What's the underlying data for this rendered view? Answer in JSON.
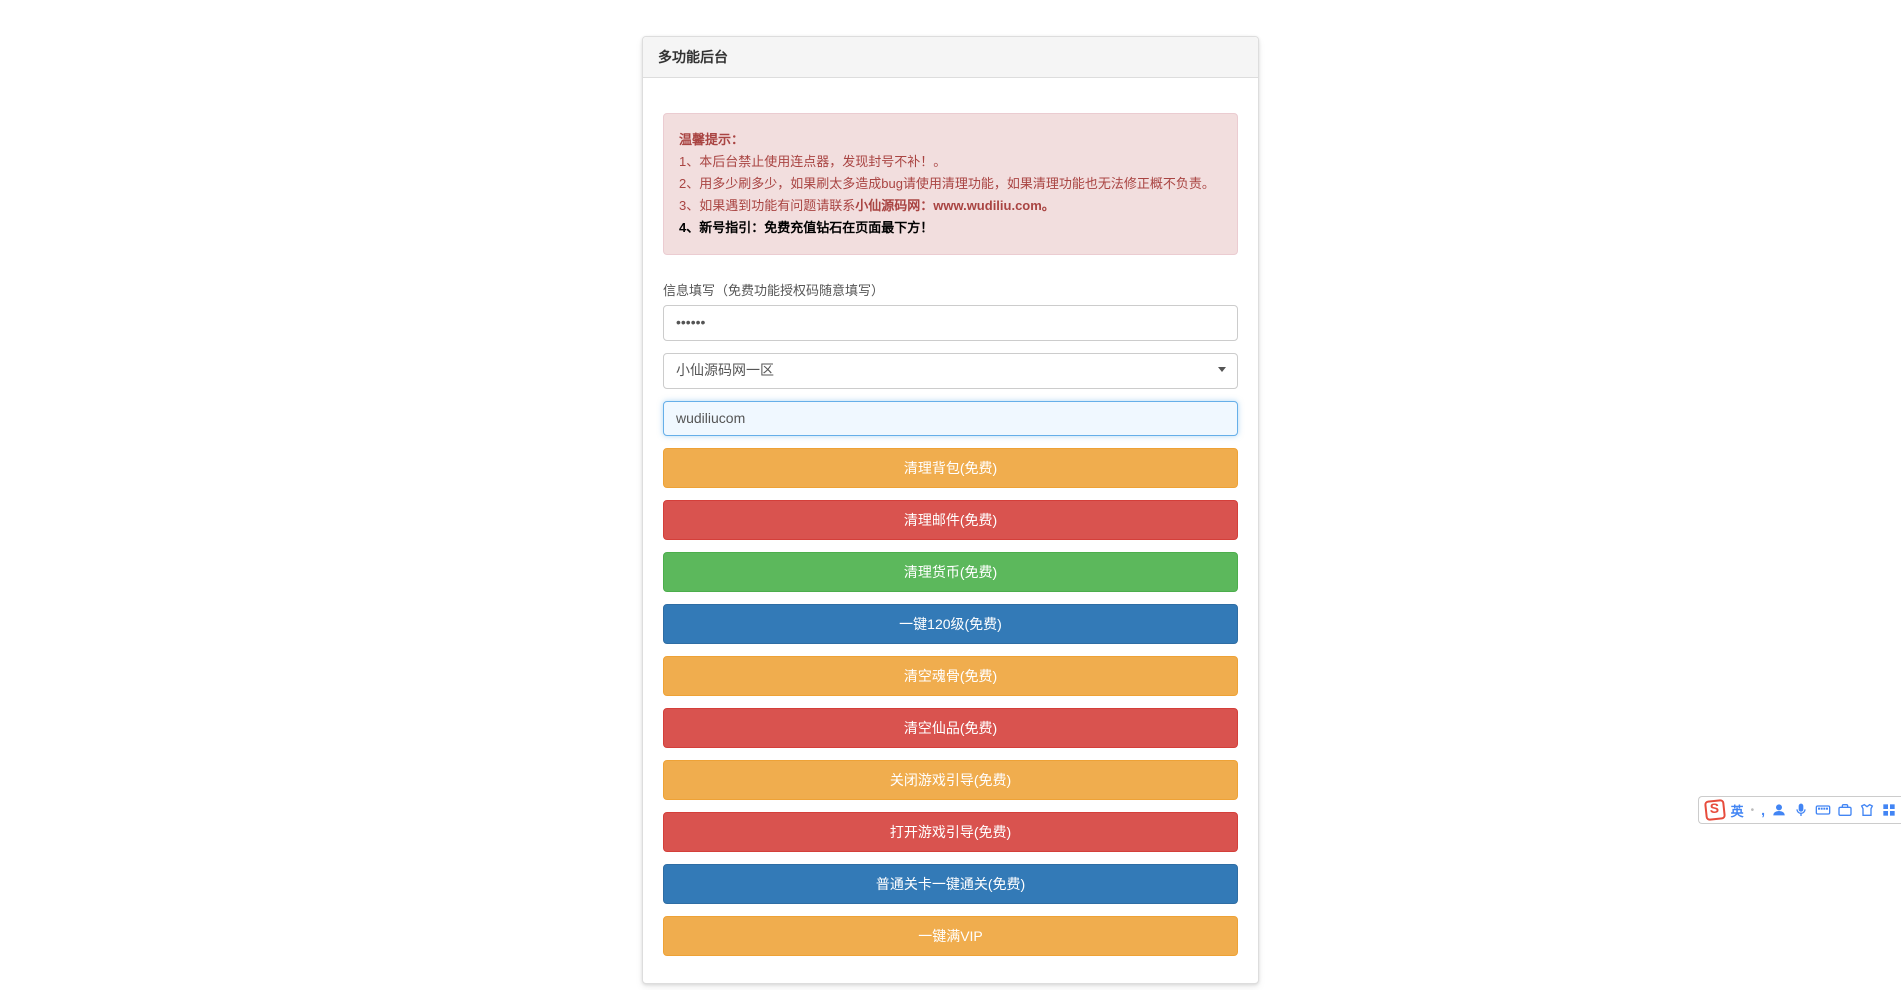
{
  "panel": {
    "title": "多功能后台"
  },
  "alert": {
    "heading": "温馨提示：",
    "line1": "1、本后台禁止使用连点器，发现封号不补！。",
    "line2": "2、用多少刷多少，如果刷太多造成bug请使用清理功能，如果清理功能也无法修正概不负责。",
    "line3_prefix": "3、如果遇到功能有问题请联系",
    "line3_link": "小仙源码网：www.wudiliu.com。",
    "line4": "4、新号指引：免费充值钻石在页面最下方！"
  },
  "form": {
    "label": "信息填写（免费功能授权码随意填写）",
    "password_value": "••••••",
    "select_value": "小仙源码网一区",
    "text_value": "wudiliucom"
  },
  "buttons": {
    "b1": "清理背包(免费)",
    "b2": "清理邮件(免费)",
    "b3": "清理货币(免费)",
    "b4": "一键120级(免费)",
    "b5": "清空魂骨(免费)",
    "b6": "清空仙品(免费)",
    "b7": "关闭游戏引导(免费)",
    "b8": "打开游戏引导(免费)",
    "b9": "普通关卡一键通关(免费)",
    "b10": "一键满VIP"
  },
  "ime": {
    "lang": "英"
  }
}
